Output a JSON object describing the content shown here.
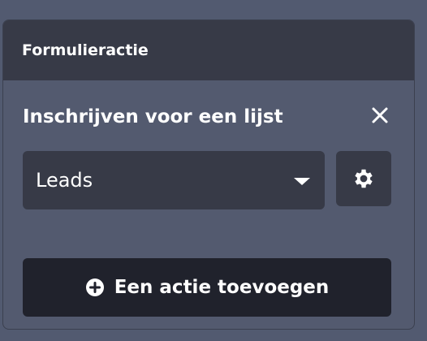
{
  "panel": {
    "title": "Formulieractie"
  },
  "action": {
    "title": "Inschrijven voor een lijst",
    "close_icon": "close-icon",
    "select": {
      "value": "Leads",
      "caret_icon": "caret-down-icon"
    },
    "settings_icon": "gear-icon"
  },
  "add_action": {
    "label": "Een actie toevoegen",
    "icon": "plus-circle-icon"
  },
  "colors": {
    "background": "#525a70",
    "header": "#373a47",
    "control": "#373a47",
    "primary_button": "#20222c",
    "text": "#ffffff"
  }
}
